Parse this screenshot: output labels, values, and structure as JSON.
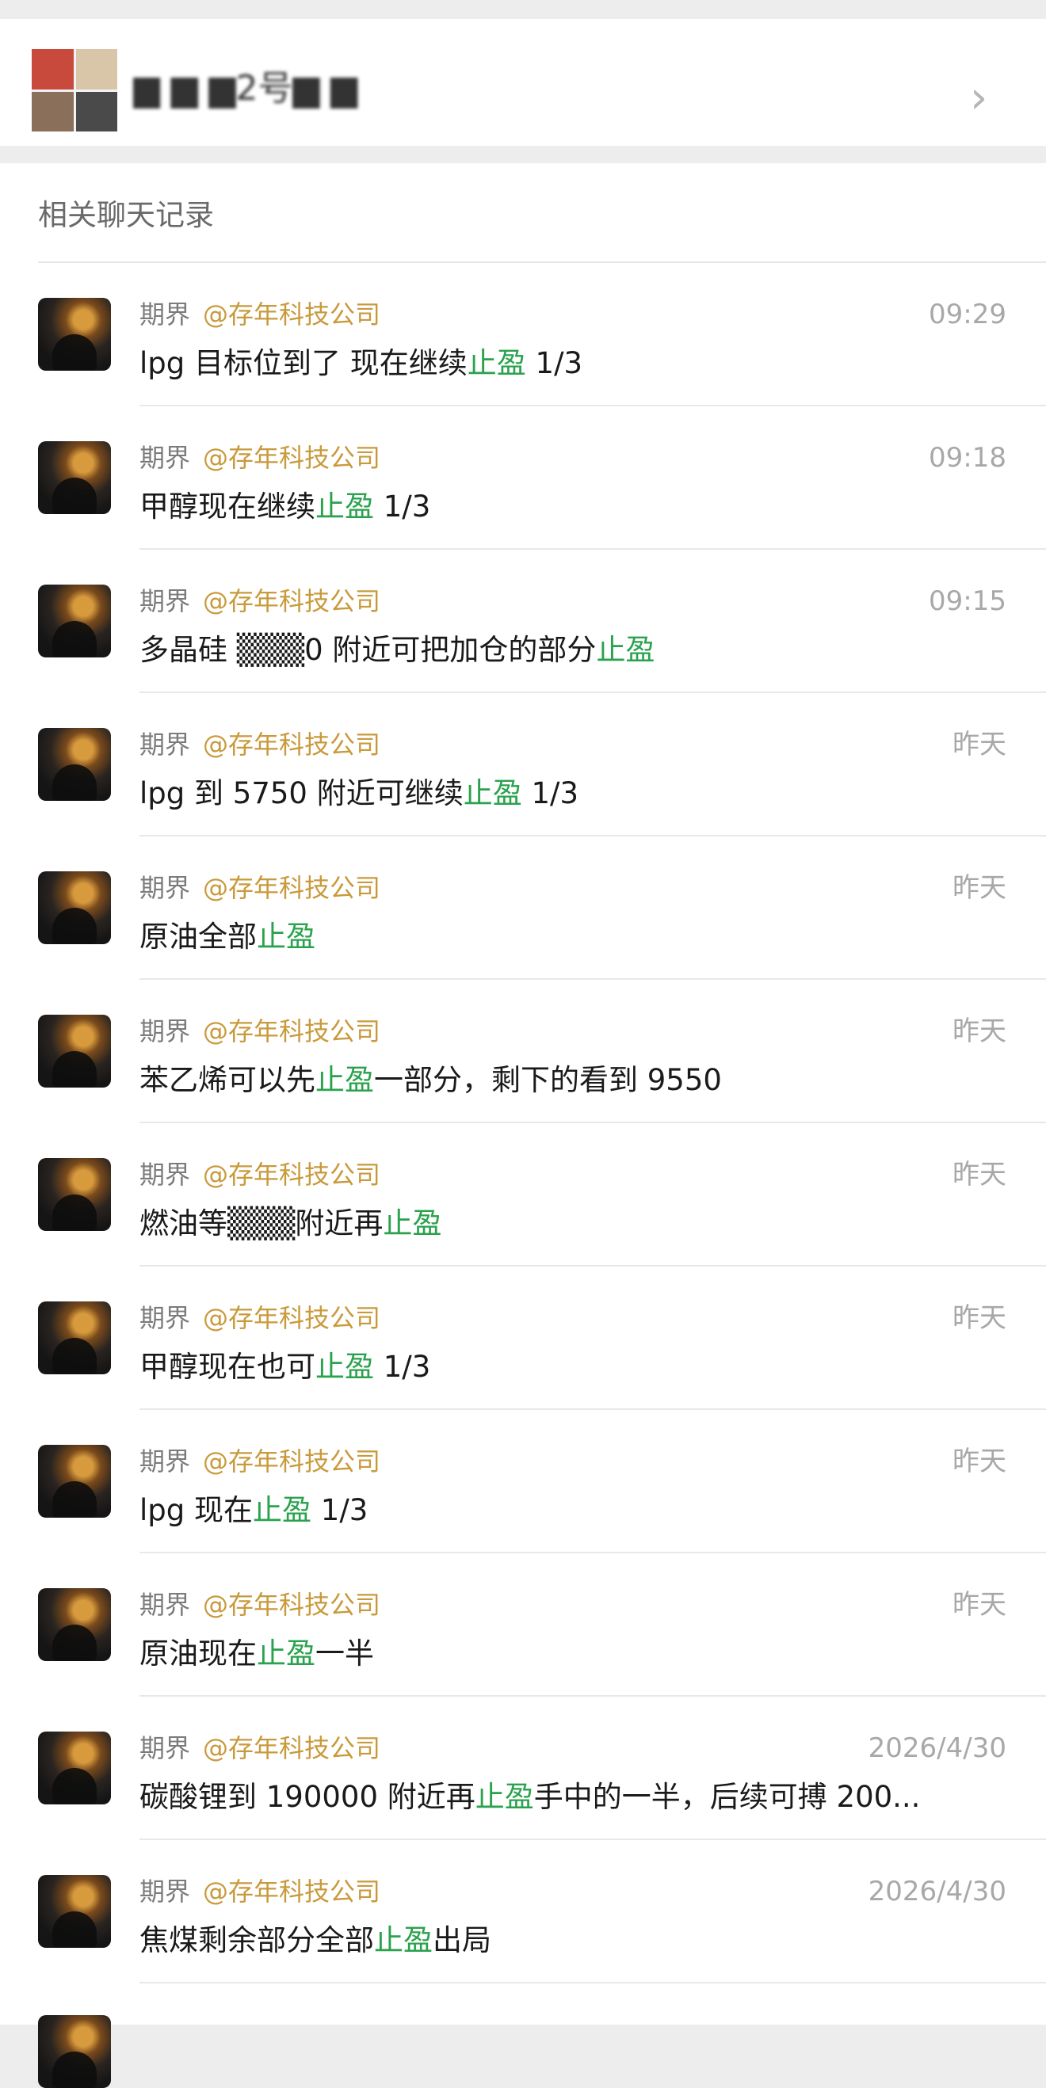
{
  "header": {
    "group_name": "▆ ▆ ▆2号▆ ▆"
  },
  "section_title": "相关聊天记录",
  "results": [
    {
      "sender": "期界",
      "mention": "@存年科技公司",
      "time": "09:29",
      "pre": "lpg 目标位到了 现在继续",
      "kw": "止盈",
      "post": " 1/3"
    },
    {
      "sender": "期界",
      "mention": "@存年科技公司",
      "time": "09:18",
      "pre": "甲醇现在继续",
      "kw": "止盈",
      "post": " 1/3"
    },
    {
      "sender": "期界",
      "mention": "@存年科技公司",
      "time": "09:15",
      "pre": "多晶硅 ▒▒▒0 附近可把加仓的部分",
      "kw": "止盈",
      "post": ""
    },
    {
      "sender": "期界",
      "mention": "@存年科技公司",
      "time": "昨天",
      "pre": "lpg 到 5750 附近可继续",
      "kw": "止盈",
      "post": " 1/3"
    },
    {
      "sender": "期界",
      "mention": "@存年科技公司",
      "time": "昨天",
      "pre": "原油全部",
      "kw": "止盈",
      "post": ""
    },
    {
      "sender": "期界",
      "mention": "@存年科技公司",
      "time": "昨天",
      "pre": "苯乙烯可以先",
      "kw": "止盈",
      "post": "一部分，剩下的看到 9550"
    },
    {
      "sender": "期界",
      "mention": "@存年科技公司",
      "time": "昨天",
      "pre": "燃油等▒▒▒附近再",
      "kw": "止盈",
      "post": ""
    },
    {
      "sender": "期界",
      "mention": "@存年科技公司",
      "time": "昨天",
      "pre": "甲醇现在也可",
      "kw": "止盈",
      "post": " 1/3"
    },
    {
      "sender": "期界",
      "mention": "@存年科技公司",
      "time": "昨天",
      "pre": "lpg 现在",
      "kw": "止盈",
      "post": " 1/3"
    },
    {
      "sender": "期界",
      "mention": "@存年科技公司",
      "time": "昨天",
      "pre": "原油现在",
      "kw": "止盈",
      "post": "一半"
    },
    {
      "sender": "期界",
      "mention": "@存年科技公司",
      "time": "2026/4/30",
      "pre": "碳酸锂到 190000 附近再",
      "kw": "止盈",
      "post": "手中的一半，后续可搏 200..."
    },
    {
      "sender": "期界",
      "mention": "@存年科技公司",
      "time": "2026/4/30",
      "pre": "焦煤剩余部分全部",
      "kw": "止盈",
      "post": "出局"
    }
  ],
  "colors": {
    "keyword": "#2aa24d",
    "mention": "#c99a3c",
    "timestamp": "#a8a8a8"
  },
  "icons": [
    "chevron-right-icon",
    "group-avatar",
    "user-avatar"
  ]
}
